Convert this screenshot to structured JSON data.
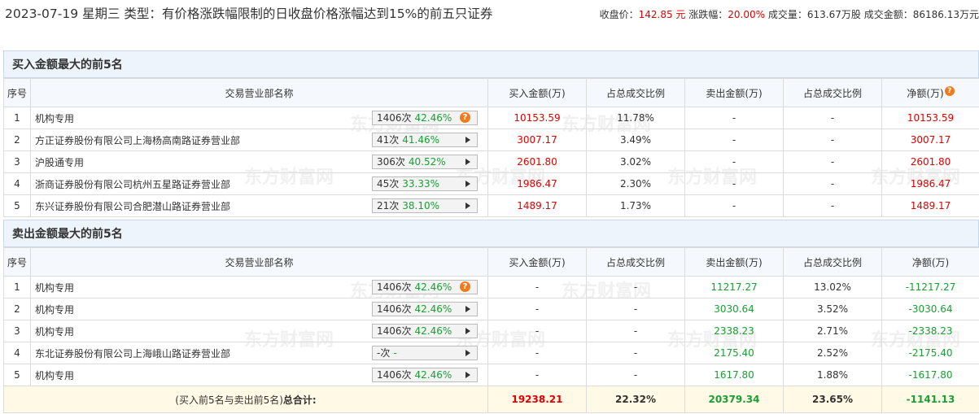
{
  "header": {
    "title": "2023-07-19 星期三 类型：有价格涨跌幅限制的日收盘价格涨幅达到15%的前五只证券",
    "close_label": "收盘价：",
    "close_value": "142.85 元",
    "change_label": "涨跌幅：",
    "change_value": "20.00%",
    "volume_label": "成交量：",
    "volume_value": "613.67万股",
    "amount_label": "成交金额：",
    "amount_value": "86186.13万元"
  },
  "watermark": "东方财富网",
  "buy_section": {
    "title": "买入金额最大的前5名",
    "columns": [
      "序号",
      "交易营业部名称",
      "买入金额(万)",
      "占总成交比例",
      "卖出金额(万)",
      "占总成交比例",
      "净额(万)"
    ],
    "rows": [
      {
        "idx": "1",
        "name": "机构专用",
        "count": "1406次",
        "rate": "42.46%",
        "icon": "question-icon",
        "buy": "10153.59",
        "buy_pct": "11.78%",
        "sell": "-",
        "sell_pct": "-",
        "net": "10153.59"
      },
      {
        "idx": "2",
        "name": "方正证券股份有限公司上海杨高南路证券营业部",
        "count": "41次",
        "rate": "41.46%",
        "icon": "arrow-right-icon",
        "buy": "3007.17",
        "buy_pct": "3.49%",
        "sell": "-",
        "sell_pct": "-",
        "net": "3007.17"
      },
      {
        "idx": "3",
        "name": "沪股通专用",
        "count": "306次",
        "rate": "40.52%",
        "icon": "arrow-right-icon",
        "buy": "2601.80",
        "buy_pct": "3.02%",
        "sell": "-",
        "sell_pct": "-",
        "net": "2601.80"
      },
      {
        "idx": "4",
        "name": "浙商证券股份有限公司杭州五星路证券营业部",
        "count": "45次",
        "rate": "33.33%",
        "icon": "arrow-right-icon",
        "buy": "1986.47",
        "buy_pct": "2.30%",
        "sell": "-",
        "sell_pct": "-",
        "net": "1986.47"
      },
      {
        "idx": "5",
        "name": "东兴证券股份有限公司合肥潜山路证券营业部",
        "count": "21次",
        "rate": "38.10%",
        "icon": "arrow-right-icon",
        "buy": "1489.17",
        "buy_pct": "1.73%",
        "sell": "-",
        "sell_pct": "-",
        "net": "1489.17"
      }
    ]
  },
  "sell_section": {
    "title": "卖出金额最大的前5名",
    "columns": [
      "序号",
      "交易营业部名称",
      "买入金额(万)",
      "占总成交比例",
      "卖出金额(万)",
      "占总成交比例",
      "净额(万)"
    ],
    "rows": [
      {
        "idx": "1",
        "name": "机构专用",
        "count": "1406次",
        "rate": "42.46%",
        "icon": "question-icon",
        "buy": "-",
        "buy_pct": "-",
        "sell": "11217.27",
        "sell_pct": "13.02%",
        "net": "-11217.27"
      },
      {
        "idx": "2",
        "name": "机构专用",
        "count": "1406次",
        "rate": "42.46%",
        "icon": "arrow-right-icon",
        "buy": "-",
        "buy_pct": "-",
        "sell": "3030.64",
        "sell_pct": "3.52%",
        "net": "-3030.64"
      },
      {
        "idx": "3",
        "name": "机构专用",
        "count": "1406次",
        "rate": "42.46%",
        "icon": "arrow-right-icon",
        "buy": "-",
        "buy_pct": "-",
        "sell": "2338.23",
        "sell_pct": "2.71%",
        "net": "-2338.23"
      },
      {
        "idx": "4",
        "name": "东北证券股份有限公司上海峨山路证券营业部",
        "count": "-次",
        "rate": "-",
        "icon": "arrow-right-icon",
        "buy": "-",
        "buy_pct": "-",
        "sell": "2175.40",
        "sell_pct": "2.52%",
        "net": "-2175.40"
      },
      {
        "idx": "5",
        "name": "机构专用",
        "count": "1406次",
        "rate": "42.46%",
        "icon": "arrow-right-icon",
        "buy": "-",
        "buy_pct": "-",
        "sell": "1617.80",
        "sell_pct": "1.88%",
        "net": "-1617.80"
      }
    ]
  },
  "totals": {
    "label_prefix": "(买入前5名与卖出前5名)",
    "label_bold": "总合计:",
    "buy": "19238.21",
    "buy_pct": "22.32%",
    "sell": "20379.34",
    "sell_pct": "23.65%",
    "net": "-1141.13"
  },
  "colors": {
    "up": "#e00000",
    "down": "#18a033",
    "accent": "#f07b1a",
    "header_bg": "#eef4fb"
  }
}
